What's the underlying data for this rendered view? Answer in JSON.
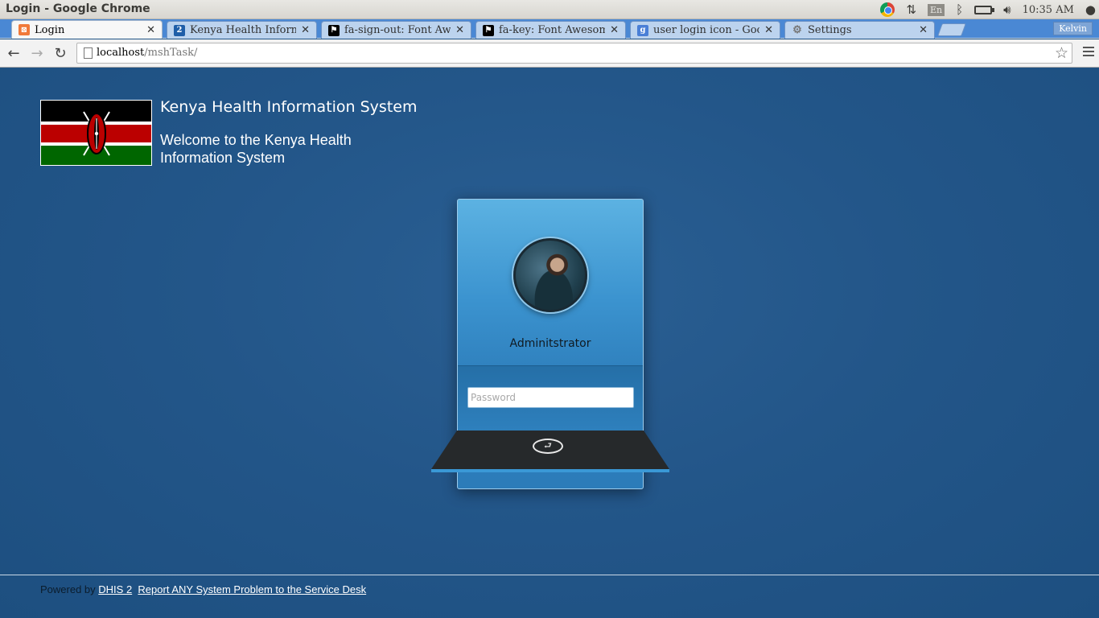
{
  "window": {
    "title": "Login - Google Chrome"
  },
  "tray": {
    "lang": "En",
    "clock": "10:35 AM"
  },
  "tabs": [
    {
      "label": "Login",
      "favicon": "xampp-icon",
      "color": "#f0793a"
    },
    {
      "label": "Kenya Health Informatic",
      "favicon": "dhis2-icon",
      "color": "#1f5ea8"
    },
    {
      "label": "fa-sign-out: Font Awesom",
      "favicon": "flag-icon",
      "color": "#000000"
    },
    {
      "label": "fa-key: Font Awesome Ic",
      "favicon": "flag-icon",
      "color": "#000000"
    },
    {
      "label": "user login icon - Google",
      "favicon": "google-icon",
      "color": "#4a7fd6"
    },
    {
      "label": "Settings",
      "favicon": "gear-icon",
      "color": "#777777"
    }
  ],
  "profile": "Kelvin",
  "omnibox": {
    "host": "localhost",
    "path": "/mshTask/"
  },
  "header": {
    "title": "Kenya Health Information System",
    "subtitle": "Welcome to the Kenya Health Information System"
  },
  "login": {
    "username": "Adminitstrator",
    "password_placeholder": "Password"
  },
  "footer": {
    "powered_by": "Powered by",
    "dhis_link": "DHIS 2",
    "report_link": "Report ANY System Problem to the Service Desk"
  }
}
